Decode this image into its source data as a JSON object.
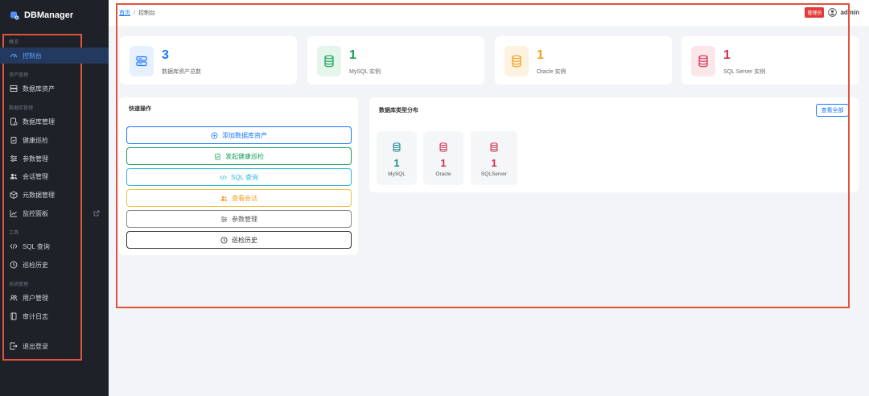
{
  "app": {
    "title": "DBManager"
  },
  "sidebar": {
    "sections": {
      "overview": "概览",
      "assets": "资产管理",
      "db_manage": "数据库管理",
      "tools": "工具",
      "system": "系统管理"
    },
    "items": {
      "dashboard": "控制台",
      "db_assets": "数据库资产",
      "db_manage": "数据库管理",
      "health_check": "健康巡检",
      "param_manage": "参数管理",
      "session_manage": "会话管理",
      "metadata_manage": "元数据管理",
      "monitor_panel": "监控面板",
      "sql_query": "SQL 查询",
      "check_history": "巡检历史",
      "user_manage": "用户管理",
      "audit_log": "审计日志",
      "logout": "退出登录"
    }
  },
  "header": {
    "breadcrumb_home": "首页",
    "breadcrumb_sep": "/",
    "breadcrumb_current": "控制台",
    "role_badge": "管理员",
    "username": "admin"
  },
  "stats": [
    {
      "value": "3",
      "label": "数据库资产总数",
      "color": "#1677ff",
      "bg": "#e6f0ff"
    },
    {
      "value": "1",
      "label": "MySQL 实例",
      "color": "#18a058",
      "bg": "#e4f6ec"
    },
    {
      "value": "1",
      "label": "Oracle 实例",
      "color": "#f0a020",
      "bg": "#fdf2e0"
    },
    {
      "value": "1",
      "label": "SQL Server 实例",
      "color": "#d03050",
      "bg": "#fbe6e9"
    }
  ],
  "quick_actions": {
    "title": "快速操作",
    "buttons": [
      {
        "label": "添加数据库资产",
        "color": "#1677ff"
      },
      {
        "label": "发起健康巡检",
        "color": "#18a058"
      },
      {
        "label": "SQL 查询",
        "color": "#2ab8e0"
      },
      {
        "label": "查看会话",
        "color": "#f0a020"
      },
      {
        "label": "参数管理",
        "color": "#555555"
      },
      {
        "label": "巡检历史",
        "color": "#333333"
      }
    ]
  },
  "distribution": {
    "title": "数据库类型分布",
    "view_all": "查看全部",
    "tiles": [
      {
        "count": "1",
        "name": "MySQL",
        "color": "#1f8a96"
      },
      {
        "count": "1",
        "name": "Oracle",
        "color": "#d03050"
      },
      {
        "count": "1",
        "name": "SQLServer",
        "color": "#d03050"
      }
    ]
  }
}
